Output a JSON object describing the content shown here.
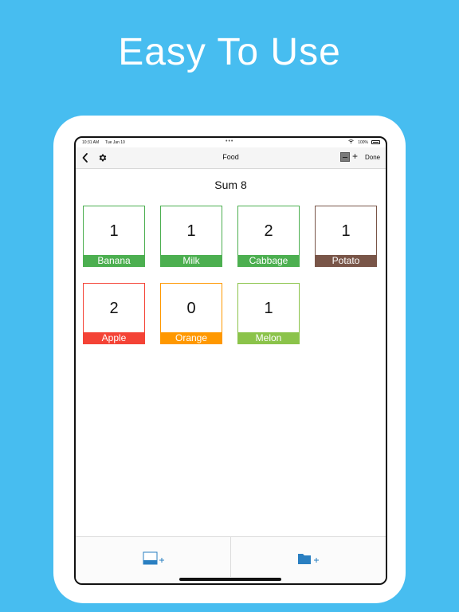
{
  "headline": "Easy To Use",
  "status": {
    "time": "10:31 AM",
    "date": "Tue Jan 10",
    "dots": "•••",
    "battery": "100%"
  },
  "nav": {
    "title": "Food",
    "plus": "+",
    "done": "Done"
  },
  "sum": "Sum 8",
  "items": [
    {
      "name": "Banana",
      "count": "1",
      "color": "#4caf50"
    },
    {
      "name": "Milk",
      "count": "1",
      "color": "#4caf50"
    },
    {
      "name": "Cabbage",
      "count": "2",
      "color": "#4caf50"
    },
    {
      "name": "Potato",
      "count": "1",
      "color": "#795548"
    },
    {
      "name": "Apple",
      "count": "2",
      "color": "#f44336"
    },
    {
      "name": "Orange",
      "count": "0",
      "color": "#ff9800"
    },
    {
      "name": "Melon",
      "count": "1",
      "color": "#8bc34a"
    }
  ],
  "colors": {
    "background": "#47bdf0",
    "icon_blue": "#2a7fc1"
  }
}
